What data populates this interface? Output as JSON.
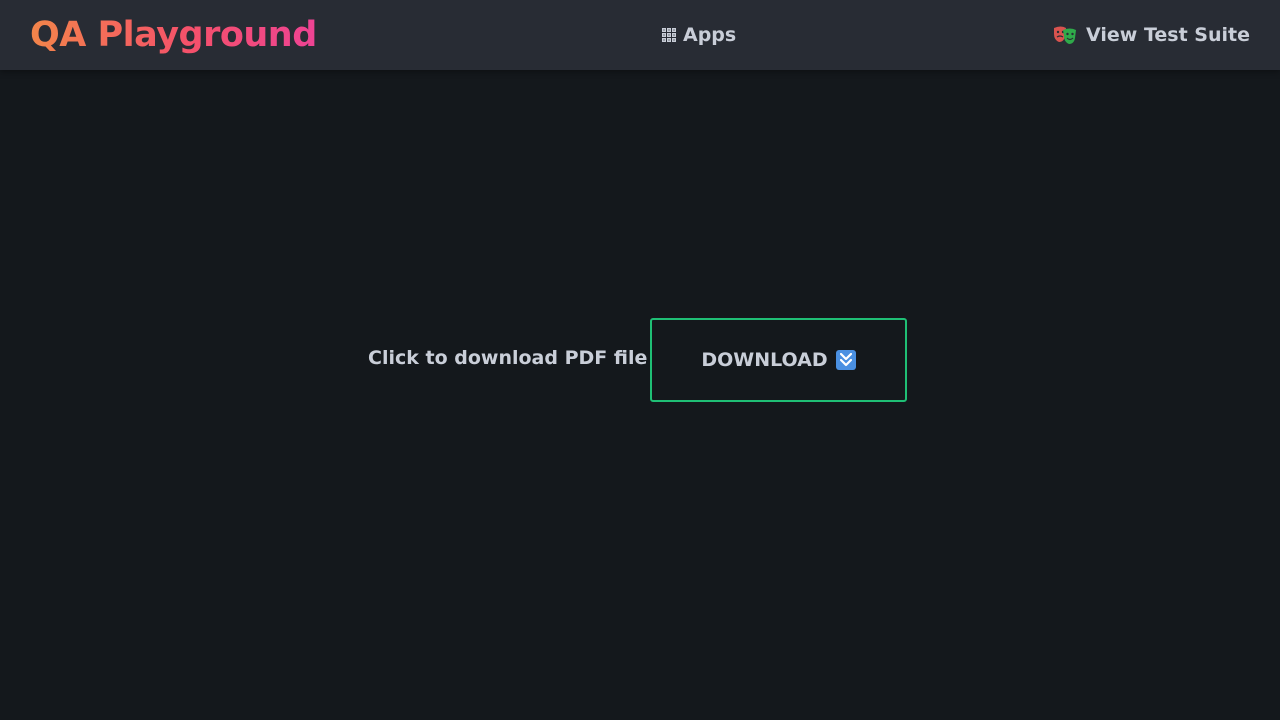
{
  "header": {
    "logo_text": "QA Playground",
    "nav": {
      "apps_label": "Apps",
      "apps_icon": "grid-icon",
      "test_suite_label": "View Test Suite",
      "test_suite_icon": "theater-masks-icon"
    }
  },
  "main": {
    "prompt_text": "Click to download PDF file",
    "download_button": {
      "label": "DOWNLOAD",
      "icon": "double-down-arrow-icon",
      "border_color": "#1fbf75"
    }
  },
  "colors": {
    "background": "#14181c",
    "header_background": "#282c34",
    "text": "#c9ced8",
    "logo_gradient": [
      "#f2854a",
      "#f5516a",
      "#ee4394"
    ]
  }
}
